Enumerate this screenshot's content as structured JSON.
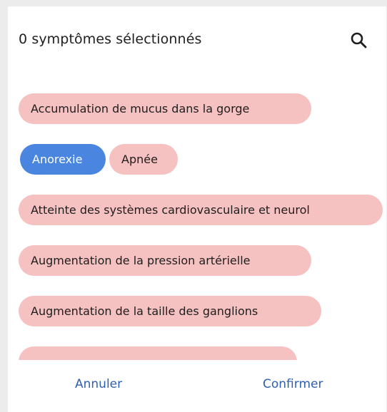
{
  "dialog": {
    "title": "0 symptômes sélectionnés",
    "search_icon": "search-icon"
  },
  "symptoms": [
    {
      "label": "Accumulation de mucus dans la gorge",
      "selected": false
    },
    {
      "label": "Anorexie",
      "selected": true
    },
    {
      "label": "Apnée",
      "selected": false
    },
    {
      "label": "Atteinte des systèmes cardiovasculaire et neurol",
      "selected": false
    },
    {
      "label": "Augmentation de la pression artérielle",
      "selected": false
    },
    {
      "label": "Augmentation de la taille des ganglions",
      "selected": false
    }
  ],
  "footer": {
    "cancel_label": "Annuler",
    "confirm_label": "Confirmer"
  },
  "colors": {
    "chip_unselected": "#f6c1c1",
    "chip_selected": "#4a86e0",
    "action_text": "#2f5fb0"
  }
}
